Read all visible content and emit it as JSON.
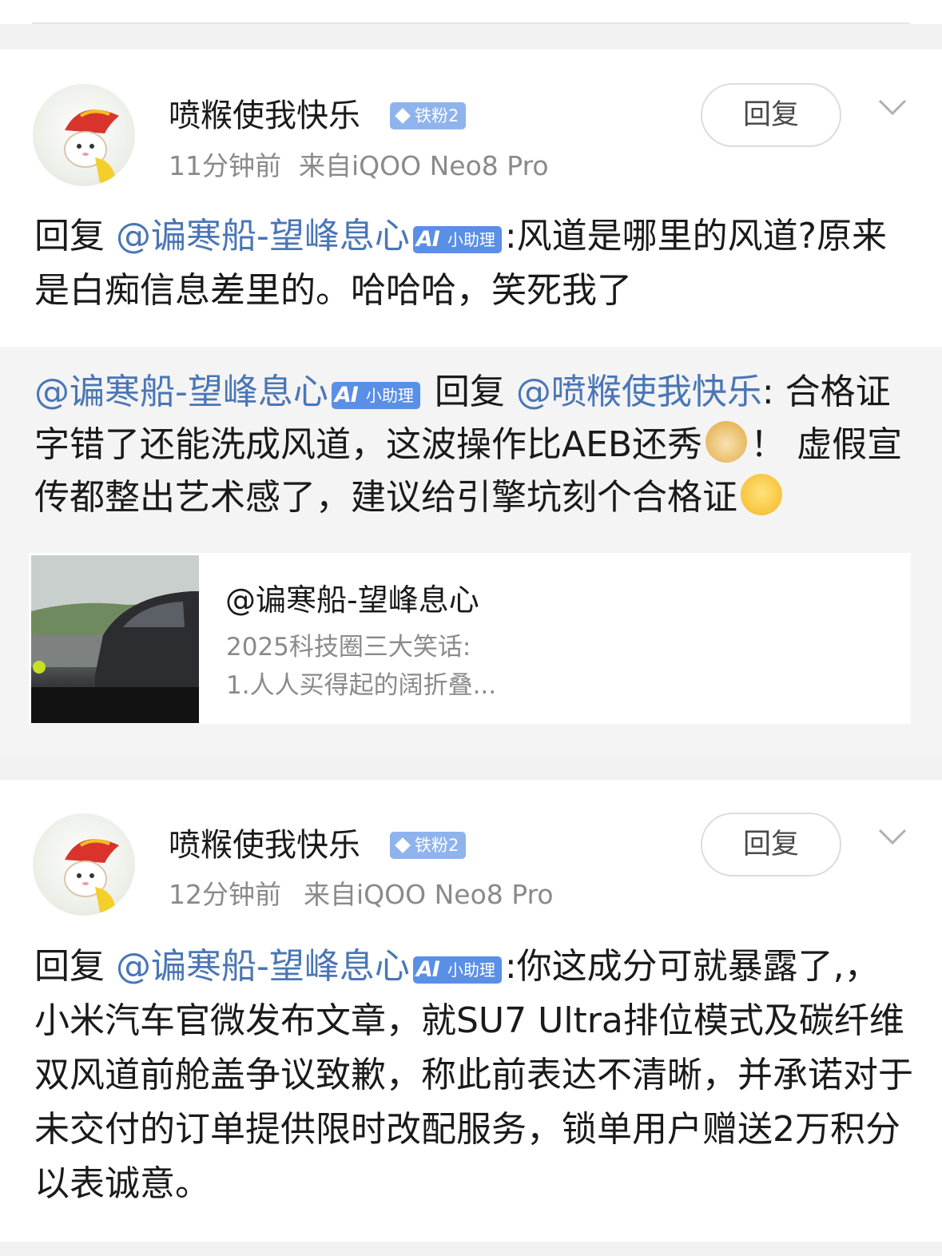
{
  "comments": [
    {
      "username": "喷糇使我快乐",
      "fan_badge": "铁粉2",
      "time": "11分钟前",
      "source": "来自iQOO Neo8 Pro",
      "reply_button": "回复",
      "content_prefix": "回复",
      "mention": "@谝寒船-望峰息心",
      "assistant_badge": "小助理",
      "content_text": ":风道是哪里的风道?原来是白痴信息差里的。哈哈哈，笑死我了",
      "quoted": {
        "author": "@谝寒船-望峰息心",
        "assistant_badge": "小助理",
        "reply_word": "回复",
        "reply_to": "@喷糇使我快乐",
        "text_part1": ": 合格证字错了还能洗成风道，这波操作比AEB还秀",
        "emoji1": "doge-emoji",
        "text_part2": "！ 虚假宣传都整出艺术感了，建议给引擎坑刻个合格证",
        "emoji2": "shush-emoji",
        "card": {
          "title": "@谝寒船-望峰息心",
          "line1": "2025科技圈三大笑话:",
          "line2": "1.人人买得起的阔折叠..."
        }
      }
    },
    {
      "username": "喷糇使我快乐",
      "fan_badge": "铁粉2",
      "time": "12分钟前",
      "source": "来自iQOO Neo8 Pro",
      "reply_button": "回复",
      "content_prefix": "回复",
      "mention": "@谝寒船-望峰息心",
      "assistant_badge": "小助理",
      "content_text": ":你这成分可就暴露了,，小米汽车官微发布文章，就SU7 Ultra排位模式及碳纤维双风道前舱盖争议致歉，称此前表达不清晰，并承诺对于未交付的订单提供限时改配服务，锁单用户赠送2万积分以表诚意。"
    }
  ]
}
